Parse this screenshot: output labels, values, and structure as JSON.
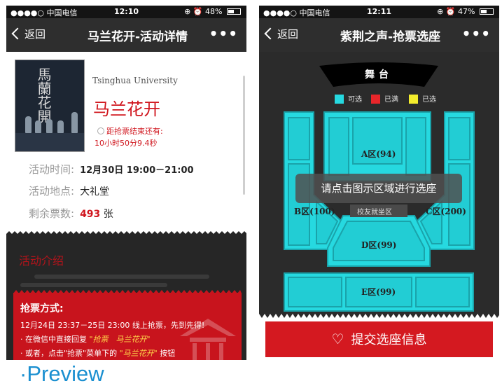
{
  "status_left": {
    "carrier": "●●●●○ 中国电信",
    "time": "12:10",
    "battery": "48%"
  },
  "status_right": {
    "carrier": "●●●●○ 中国电信",
    "time": "12:11",
    "battery": "47%"
  },
  "left_screen": {
    "back_label": "返回",
    "title": "马兰花开-活动详情",
    "more": "•••",
    "university": "Tsinghua University",
    "activity_title": "马兰花开",
    "countdown_line1": "距抢票结束还有:",
    "countdown_line2": "10小时50分9.4秒",
    "time_label": "活动时间:",
    "time_value": "12月30日 19:00－21:00",
    "place_label": "活动地点:",
    "place_value": "大礼堂",
    "tickets_label": "剩余票数:",
    "tickets_value": "493",
    "tickets_unit": "张",
    "intro_title": "活动介绍",
    "grab_title": "抢票方式:",
    "grab_line1": "12月24日 23:37－25日 23:00 线上抢票，先到先得!",
    "grab_line2_pre": "· 在微信中直接回复",
    "grab_line2_hl": "\"抢票　马兰花开\"",
    "grab_line3_pre": "· 或者，点击\"抢票\"菜单下的",
    "grab_line3_hl": "\"马兰花开\"",
    "grab_line3_post": "按钮"
  },
  "right_screen": {
    "back_label": "返回",
    "title": "紫荆之声-抢票选座",
    "more": "•••",
    "stage": "舞台",
    "legend": {
      "available": "可选",
      "full": "已满",
      "selected": "已选"
    },
    "zones": {
      "a": "A区(94)",
      "b": "B区(100)",
      "c": "C区(200)",
      "d": "D区(99)",
      "e": "E区(99)",
      "alumni": "校友就坐区"
    },
    "tip": "请点击图示区域进行选座",
    "submit": "提交选座信息"
  },
  "colors": {
    "available": "#26d9e0",
    "full": "#e8262a",
    "selected": "#f2ec2c",
    "accent_red": "#d41920"
  },
  "preview_label": "·Preview"
}
